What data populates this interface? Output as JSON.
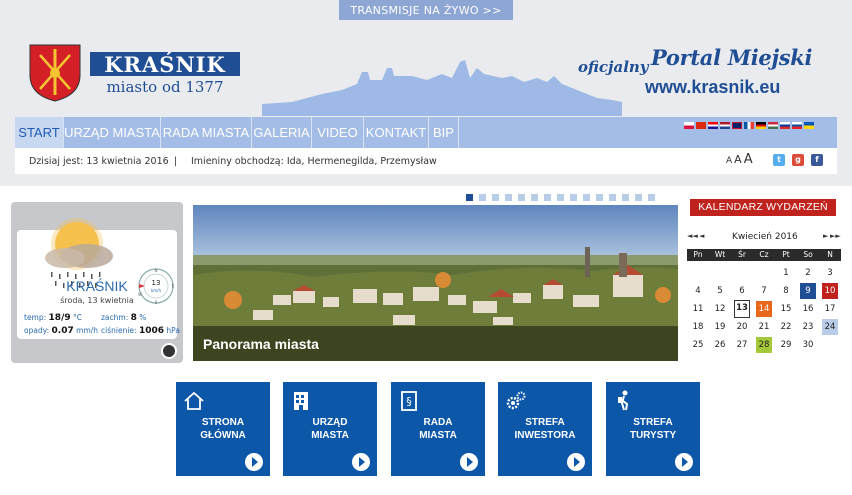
{
  "top_bar": {
    "live_label": "TRANSMISJE NA ŻYWO >>"
  },
  "logo": {
    "name": "KRAŚNIK",
    "subtitle": "miasto od 1377"
  },
  "portal": {
    "prefix": "oficjalny",
    "name": "Portal Miejski",
    "url": "www.krasnik.eu"
  },
  "nav": {
    "items": [
      {
        "label": "START",
        "active": true
      },
      {
        "label": "URZĄD MIASTA"
      },
      {
        "label": "RADA MIASTA"
      },
      {
        "label": "GALERIA"
      },
      {
        "label": "VIDEO"
      },
      {
        "label": "KONTAKT"
      },
      {
        "label": "BIP"
      }
    ],
    "flags": [
      "pl-flag-icon",
      "cn-flag-icon",
      "hr-flag-icon",
      "nl-flag-icon",
      "gb-flag-icon",
      "fr-flag-icon",
      "de-flag-icon",
      "hu-flag-icon",
      "ru-flag-icon",
      "sk-flag-icon",
      "ua-flag-icon"
    ]
  },
  "infobar": {
    "date": "Dzisiaj jest: 13 kwietnia 2016",
    "separator": "|",
    "names": "Imieniny obchodzą: Ida, Hermenegilda, Przemysław",
    "font_small": "A",
    "font_medium": "A",
    "font_large": "A",
    "social": [
      "twitter-icon",
      "google-plus-icon",
      "facebook-icon"
    ]
  },
  "weather": {
    "city": "KRAŚNIK",
    "day": "środa, 13 kwietnia",
    "temp_label": "temp:",
    "temp_value": "18/9",
    "temp_unit": "°C",
    "cloud_label": "zachm:",
    "cloud_value": "8",
    "cloud_unit": "%",
    "rain_label": "opady:",
    "rain_value": "0.07",
    "rain_unit": "mm/h",
    "pressure_label": "ciśnienie:",
    "pressure_value": "1006",
    "pressure_unit": "hPa",
    "wind_speed": "13",
    "wind_unit": "km/h",
    "compass": [
      "N",
      "E",
      "S",
      "W"
    ]
  },
  "slider": {
    "caption": "Panorama miasta",
    "dots_total": 15,
    "active_dot": 0
  },
  "calendar": {
    "title": "KALENDARZ WYDARZEŃ",
    "month": "Kwiecień 2016",
    "prev_year": "◄◄",
    "prev_month": "◄",
    "next_month": "►",
    "next_year": "►►",
    "weekdays": [
      "Pn",
      "Wt",
      "Śr",
      "Cz",
      "Pt",
      "So",
      "N"
    ],
    "weeks": [
      [
        "",
        "",
        "",
        "",
        "1",
        "2",
        "3"
      ],
      [
        "4",
        "5",
        "6",
        "7",
        "8",
        "9",
        "10"
      ],
      [
        "11",
        "12",
        "13",
        "14",
        "15",
        "16",
        "17"
      ],
      [
        "18",
        "19",
        "20",
        "21",
        "22",
        "23",
        "24"
      ],
      [
        "25",
        "26",
        "27",
        "28",
        "29",
        "30",
        ""
      ]
    ],
    "highlights": {
      "9": "#1f4e94",
      "10": "#c0221d",
      "13": "today",
      "14": "#e8671a",
      "24": "#b9cde9",
      "28": "#a5c83b"
    }
  },
  "tiles": [
    {
      "line1": "STRONA",
      "line2": "GŁÓWNA",
      "icon": "home-icon"
    },
    {
      "line1": "URZĄD",
      "line2": "MIASTA",
      "icon": "building-icon"
    },
    {
      "line1": "RADA",
      "line2": "MIASTA",
      "icon": "document-paragraph-icon"
    },
    {
      "line1": "STREFA",
      "line2": "INWESTORA",
      "icon": "gears-icon"
    },
    {
      "line1": "STREFA",
      "line2": "TURYSTY",
      "icon": "tourist-icon"
    }
  ],
  "colors": {
    "brand": "#1f4e94",
    "nav_bg": "#a4bde6",
    "tile_bg": "#0d57a8",
    "calendar_header": "#c0221d"
  }
}
